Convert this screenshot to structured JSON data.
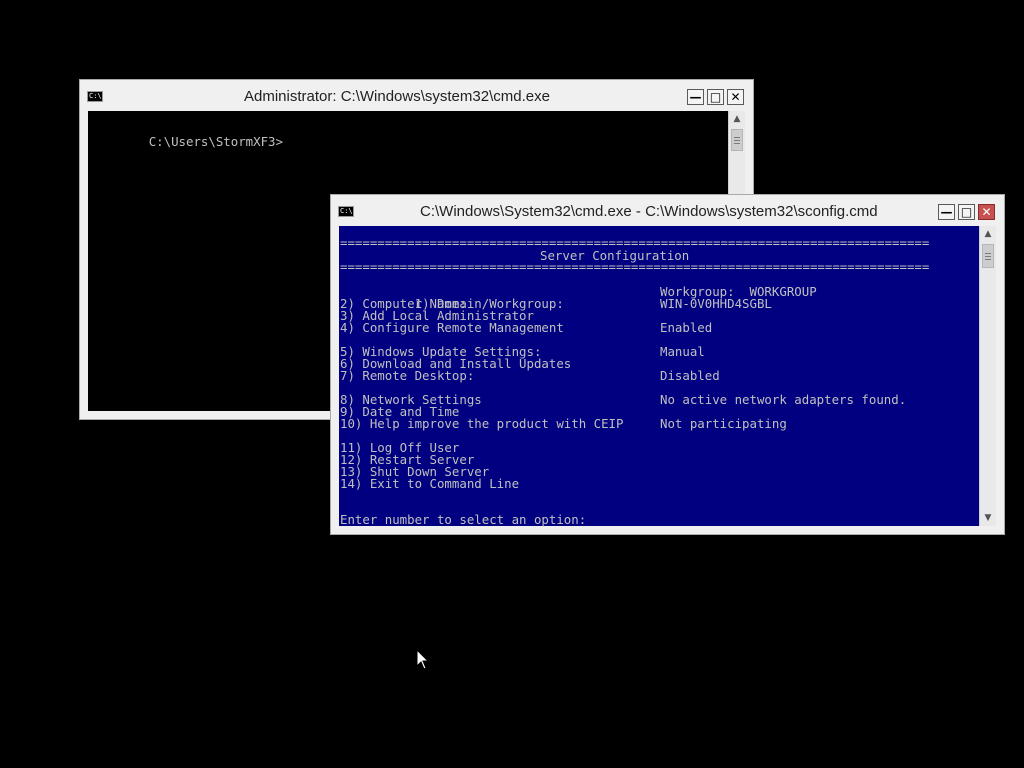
{
  "windows": {
    "admin_cmd": {
      "title": "Administrator: C:\\Windows\\system32\\cmd.exe",
      "icon_label": "C:\\",
      "prompt": "C:\\Users\\StormXF3>"
    },
    "sconfig": {
      "title": "C:\\Windows\\System32\\cmd.exe - C:\\Windows\\system32\\sconfig.cmd",
      "icon_label": "C:\\",
      "separator": "===============================================================================",
      "heading": "Server Configuration",
      "menu": [
        {
          "label": "1) Domain/Workgroup:",
          "value": "Workgroup:  WORKGROUP"
        },
        {
          "label": "2) Computer Name:",
          "value": "WIN-0V0HHD4SGBL"
        },
        {
          "label": "3) Add Local Administrator",
          "value": ""
        },
        {
          "label": "4) Configure Remote Management",
          "value": "Enabled"
        },
        {
          "label": "5) Windows Update Settings:",
          "value": "Manual"
        },
        {
          "label": "6) Download and Install Updates",
          "value": ""
        },
        {
          "label": "7) Remote Desktop:",
          "value": "Disabled"
        },
        {
          "label": "8) Network Settings",
          "value": "No active network adapters found."
        },
        {
          "label": "9) Date and Time",
          "value": ""
        },
        {
          "label": "10) Help improve the product with CEIP",
          "value": "Not participating"
        },
        {
          "label": "11) Log Off User",
          "value": ""
        },
        {
          "label": "12) Restart Server",
          "value": ""
        },
        {
          "label": "13) Shut Down Server",
          "value": ""
        },
        {
          "label": "14) Exit to Command Line",
          "value": ""
        }
      ],
      "prompt": "Enter number to select an option:"
    }
  },
  "icons": {
    "minimize": "minimize-icon",
    "maximize": "maximize-icon",
    "close": "close-icon"
  },
  "colors": {
    "sconfig_background": "#000080",
    "console_text": "#c0c0c0",
    "close_button": "#c75050"
  }
}
